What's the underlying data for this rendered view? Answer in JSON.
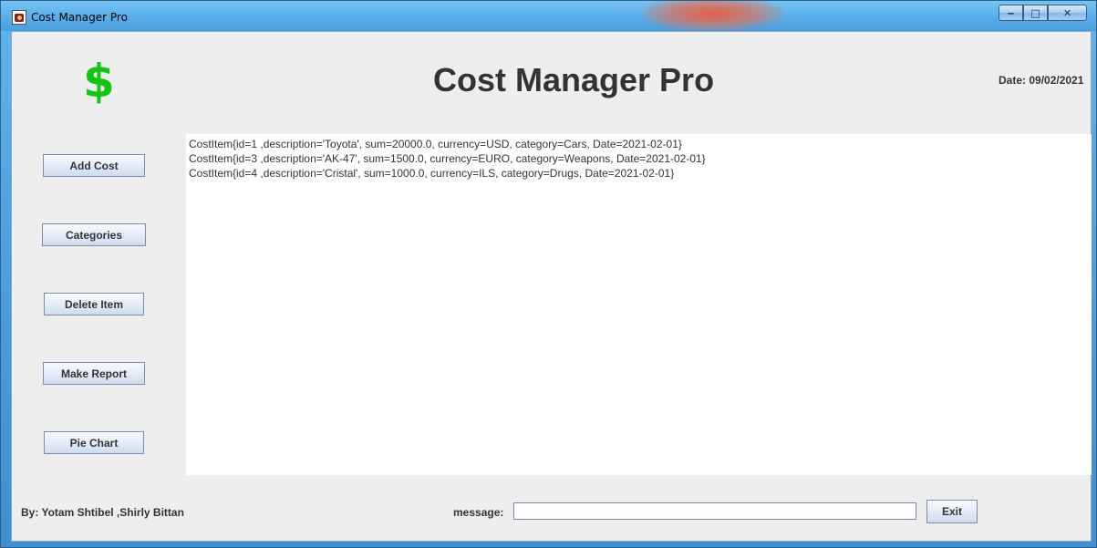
{
  "window": {
    "title": "Cost Manager Pro",
    "controls": {
      "minimize": "‒",
      "maximize": "□",
      "close": "✕"
    }
  },
  "header": {
    "logo_symbol": "$",
    "title": "Cost Manager Pro",
    "date": "Date: 09/02/2021"
  },
  "sidebar": {
    "buttons": [
      {
        "label": "Add Cost"
      },
      {
        "label": "Categories"
      },
      {
        "label": "Delete Item"
      },
      {
        "label": "Make Report"
      },
      {
        "label": "Pie Chart"
      }
    ]
  },
  "cost_list": {
    "items": [
      "CostItem{id=1 ,description='Toyota', sum=20000.0, currency=USD, category=Cars, Date=2021-02-01}",
      "CostItem{id=3 ,description='AK-47', sum=1500.0, currency=EURO, category=Weapons, Date=2021-02-01}",
      "CostItem{id=4 ,description='Cristal', sum=1000.0, currency=ILS, category=Drugs, Date=2021-02-01}"
    ]
  },
  "footer": {
    "authors": "By: Yotam Shtibel ,Shirly Bittan",
    "message_label": "message:",
    "message_value": "",
    "exit_label": "Exit"
  },
  "colors": {
    "dollar": "#11c611",
    "text": "#333333",
    "panel_bg": "#eeeeee"
  }
}
